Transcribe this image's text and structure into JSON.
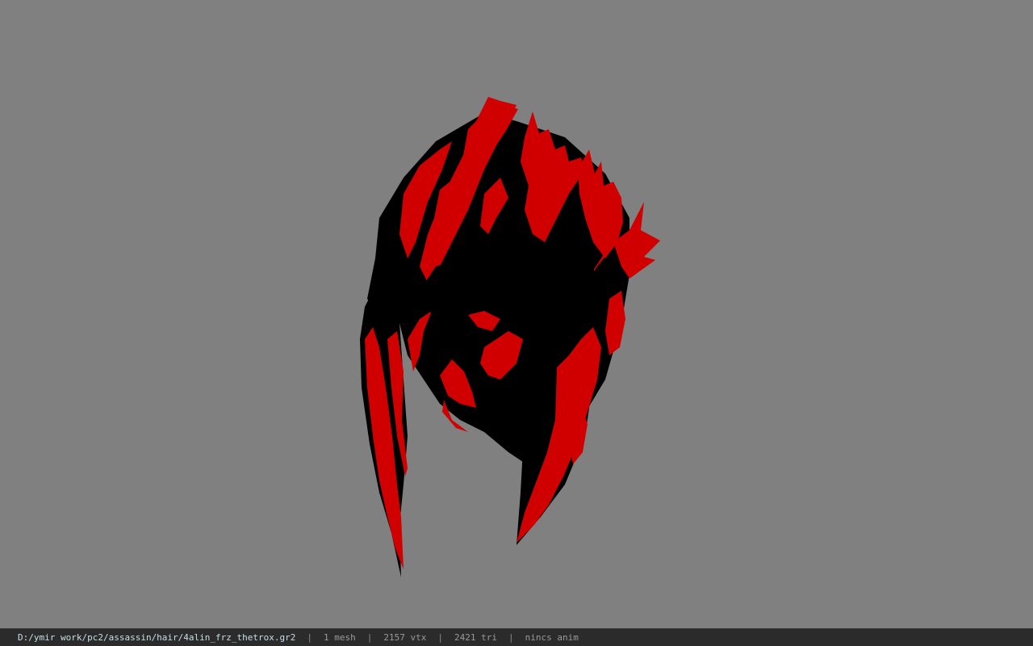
{
  "viewer": {
    "background_color": "#808080",
    "model": {
      "description_icon": "hair-mesh-model",
      "colors": {
        "primary": "#d00000",
        "shadow": "#000000"
      }
    }
  },
  "status_bar": {
    "file_path": "D:/ymir work/pc2/assassin/hair/4alin_frz_thetrox.gr2",
    "separator": "|",
    "meshes": "1 mesh",
    "vertices": "2157 vtx",
    "triangles": "2421 tri",
    "animation": "nincs anim"
  }
}
